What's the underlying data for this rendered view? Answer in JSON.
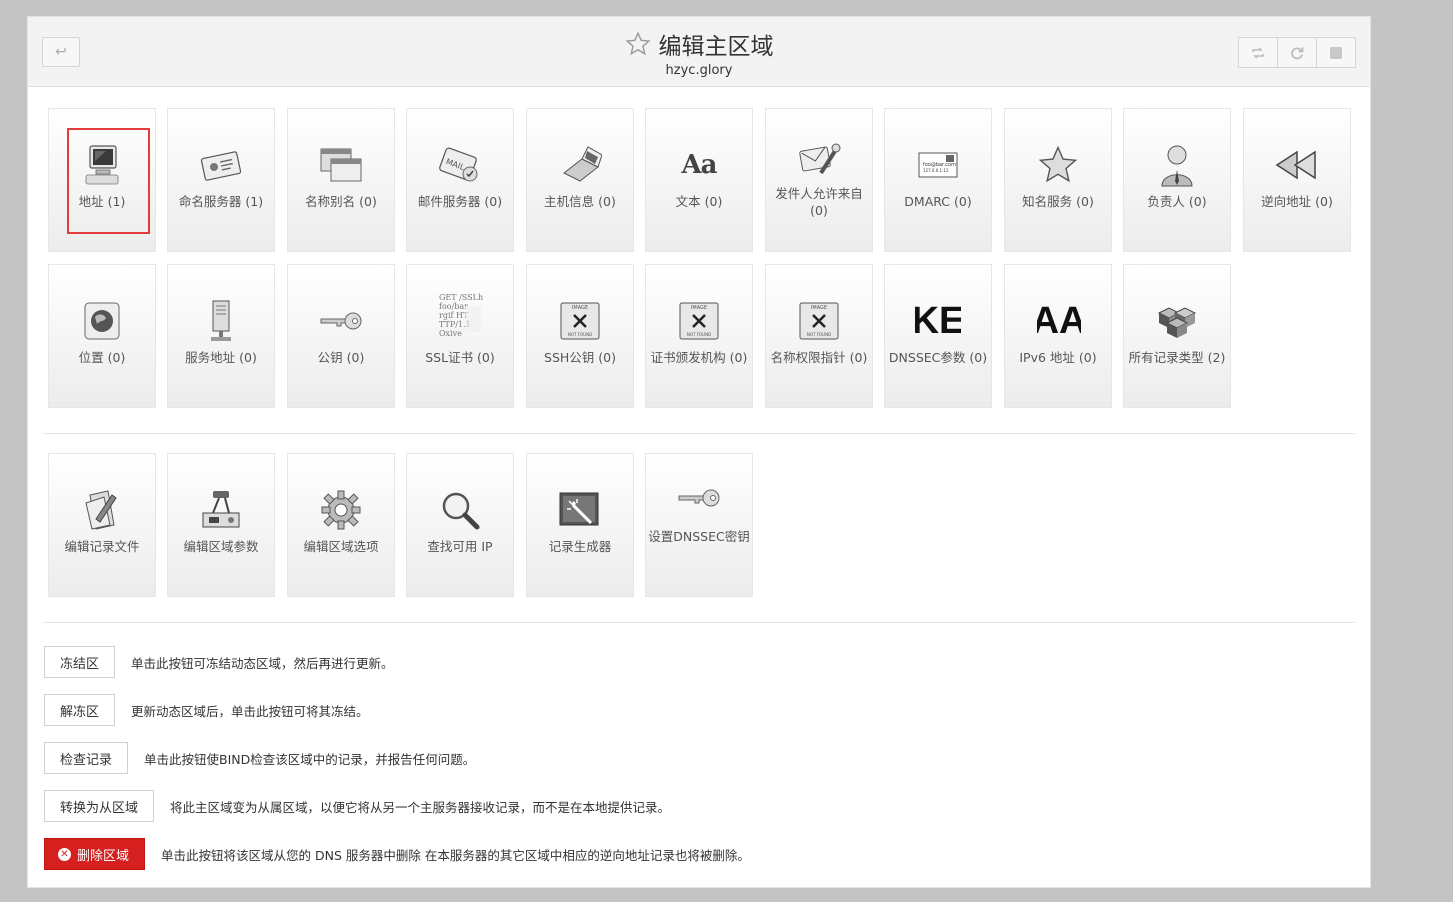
{
  "header": {
    "title": "编辑主区域",
    "subtitle": "hzyc.glory",
    "back_icon": "↩"
  },
  "records": [
    {
      "label": "地址 (1)",
      "icon": "monitor-icon"
    },
    {
      "label": "命名服务器 (1)",
      "icon": "card-icon"
    },
    {
      "label": "名称别名 (0)",
      "icon": "windows-icon"
    },
    {
      "label": "邮件服务器 (0)",
      "icon": "mail-icon"
    },
    {
      "label": "主机信息 (0)",
      "icon": "laptop-icon"
    },
    {
      "label": "文本 (0)",
      "icon": "text-icon"
    },
    {
      "label": "发件人允许来自 (0)",
      "icon": "mail-wrench-icon"
    },
    {
      "label": "DMARC (0)",
      "icon": "envelope-icon"
    },
    {
      "label": "知名服务 (0)",
      "icon": "star-icon"
    },
    {
      "label": "负责人 (0)",
      "icon": "person-icon"
    },
    {
      "label": "逆向地址 (0)",
      "icon": "rewind-icon"
    },
    {
      "label": "位置 (0)",
      "icon": "globe-icon"
    },
    {
      "label": "服务地址 (0)",
      "icon": "server-icon"
    },
    {
      "label": "公钥 (0)",
      "icon": "key-icon"
    },
    {
      "label": "SSL证书 (0)",
      "icon": "certificate-icon"
    },
    {
      "label": "SSH公钥 (0)",
      "icon": "image-not-found-icon"
    },
    {
      "label": "证书颁发机构 (0)",
      "icon": "image-not-found-icon"
    },
    {
      "label": "名称权限指针 (0)",
      "icon": "image-not-found-icon"
    },
    {
      "label": "DNSSEC参数 (0)",
      "icon": "ke-text-icon"
    },
    {
      "label": "IPv6 地址 (0)",
      "icon": "aa-text-icon"
    },
    {
      "label": "所有记录类型 (2)",
      "icon": "cubes-icon"
    }
  ],
  "img_not_found": {
    "top": "IMAGE",
    "bottom": "NOT FOUND"
  },
  "cert_text": [
    "GET /SSLh",
    "foo/bar",
    "rgif HT",
    "TTP/1.1",
    "Oxive"
  ],
  "dmarc_text": [
    "foo@bar.com",
    "127.0.0.1:12"
  ],
  "text_glyph": "Aa",
  "ke_text": "KE",
  "aa_text": "AA",
  "tools": [
    {
      "label": "编辑记录文件",
      "icon": "edit-file-icon"
    },
    {
      "label": "编辑区域参数",
      "icon": "projector-icon"
    },
    {
      "label": "编辑区域选项",
      "icon": "gear-icon"
    },
    {
      "label": "查找可用 IP",
      "icon": "magnifier-icon"
    },
    {
      "label": "记录生成器",
      "icon": "wand-icon"
    },
    {
      "label": "设置DNSSEC密钥",
      "icon": "key-icon"
    }
  ],
  "actions": [
    {
      "button": "冻结区",
      "desc": "单击此按钮可冻结动态区域，然后再进行更新。"
    },
    {
      "button": "解冻区",
      "desc": "更新动态区域后，单击此按钮可将其冻结。"
    },
    {
      "button": "检查记录",
      "desc": "单击此按钮使BIND检查该区域中的记录，并报告任何问题。"
    },
    {
      "button": "转换为从区域",
      "desc": "将此主区域变为从属区域，以便它将从另一个主服务器接收记录，而不是在本地提供记录。"
    },
    {
      "button": "删除区域",
      "desc": "单击此按钮将该区域从您的 DNS 服务器中删除 在本服务器的其它区域中相应的逆向地址记录也将被删除。"
    }
  ],
  "colors": {
    "danger": "#d62020",
    "highlight": "#e23c3c"
  }
}
